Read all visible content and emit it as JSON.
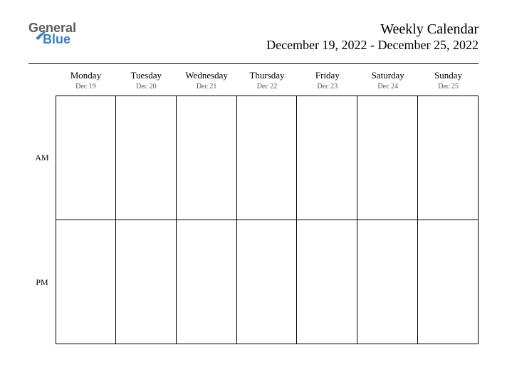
{
  "logo": {
    "line1": "General",
    "line2": "Blue"
  },
  "header": {
    "title": "Weekly Calendar",
    "date_range": "December 19, 2022 - December 25, 2022"
  },
  "periods": {
    "am": "AM",
    "pm": "PM"
  },
  "days": [
    {
      "name": "Monday",
      "date": "Dec 19"
    },
    {
      "name": "Tuesday",
      "date": "Dec 20"
    },
    {
      "name": "Wednesday",
      "date": "Dec 21"
    },
    {
      "name": "Thursday",
      "date": "Dec 22"
    },
    {
      "name": "Friday",
      "date": "Dec 23"
    },
    {
      "name": "Saturday",
      "date": "Dec 24"
    },
    {
      "name": "Sunday",
      "date": "Dec 25"
    }
  ]
}
